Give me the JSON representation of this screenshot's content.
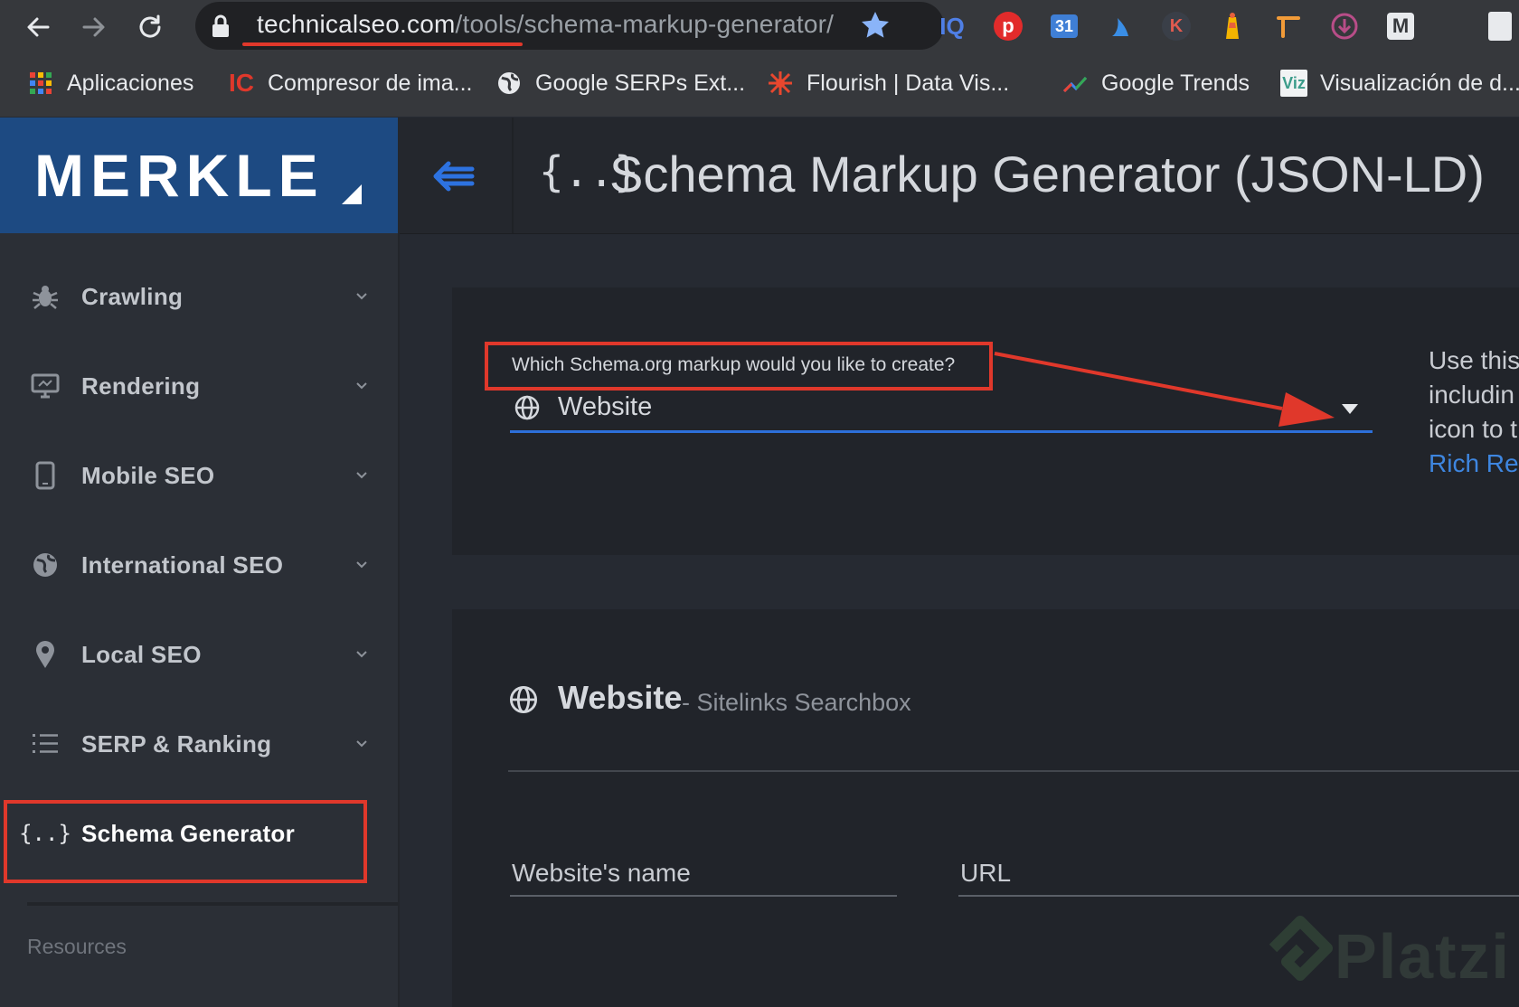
{
  "browser": {
    "url_domain": "technicalseo.com",
    "url_path": "/tools/schema-markup-generator/",
    "bookmarks": [
      {
        "label": "Aplicaciones",
        "icon": "apps-grid-icon"
      },
      {
        "label": "Compresor de ima...",
        "icon": "ic-icon"
      },
      {
        "label": "Google SERPs Ext...",
        "icon": "globe-icon"
      },
      {
        "label": "Flourish | Data Vis...",
        "icon": "flourish-icon"
      },
      {
        "label": "Google Trends",
        "icon": "trends-icon"
      },
      {
        "label": "Visualización de d...",
        "icon": "viz-icon"
      }
    ],
    "extensions": [
      "iq-icon",
      "pinterest-icon",
      "calendar-icon",
      "flame-icon",
      "k-icon",
      "lighthouse-icon",
      "pin-icon",
      "download-icon",
      "m-icon",
      "doc-icon"
    ]
  },
  "header": {
    "logo": "MERKLE",
    "title_braces": "{..}",
    "title": "Schema Markup Generator (JSON-LD)"
  },
  "sidebar": {
    "items": [
      {
        "label": "Crawling",
        "icon": "bug-icon"
      },
      {
        "label": "Rendering",
        "icon": "monitor-icon"
      },
      {
        "label": "Mobile SEO",
        "icon": "mobile-icon"
      },
      {
        "label": "International SEO",
        "icon": "globe-icon"
      },
      {
        "label": "Local SEO",
        "icon": "map-pin-icon"
      },
      {
        "label": "SERP & Ranking",
        "icon": "list-icon"
      },
      {
        "label": "Schema Generator",
        "icon": "braces-icon"
      }
    ],
    "resources_label": "Resources"
  },
  "schema_select": {
    "question": "Which Schema.org markup would you like to create?",
    "value": "Website"
  },
  "help_text": {
    "lines": [
      "Use this",
      "includin",
      "icon to t"
    ],
    "link": "Rich Res"
  },
  "section": {
    "title": "Website",
    "subtitle": "- Sitelinks Searchbox",
    "fields": {
      "name_label": "Website's name",
      "url_label": "URL"
    }
  },
  "watermark": "Platzi",
  "colors": {
    "highlight": "#e0382b",
    "brand": "#1d4a82",
    "accent": "#2d6fd9",
    "link": "#3e86e0"
  }
}
